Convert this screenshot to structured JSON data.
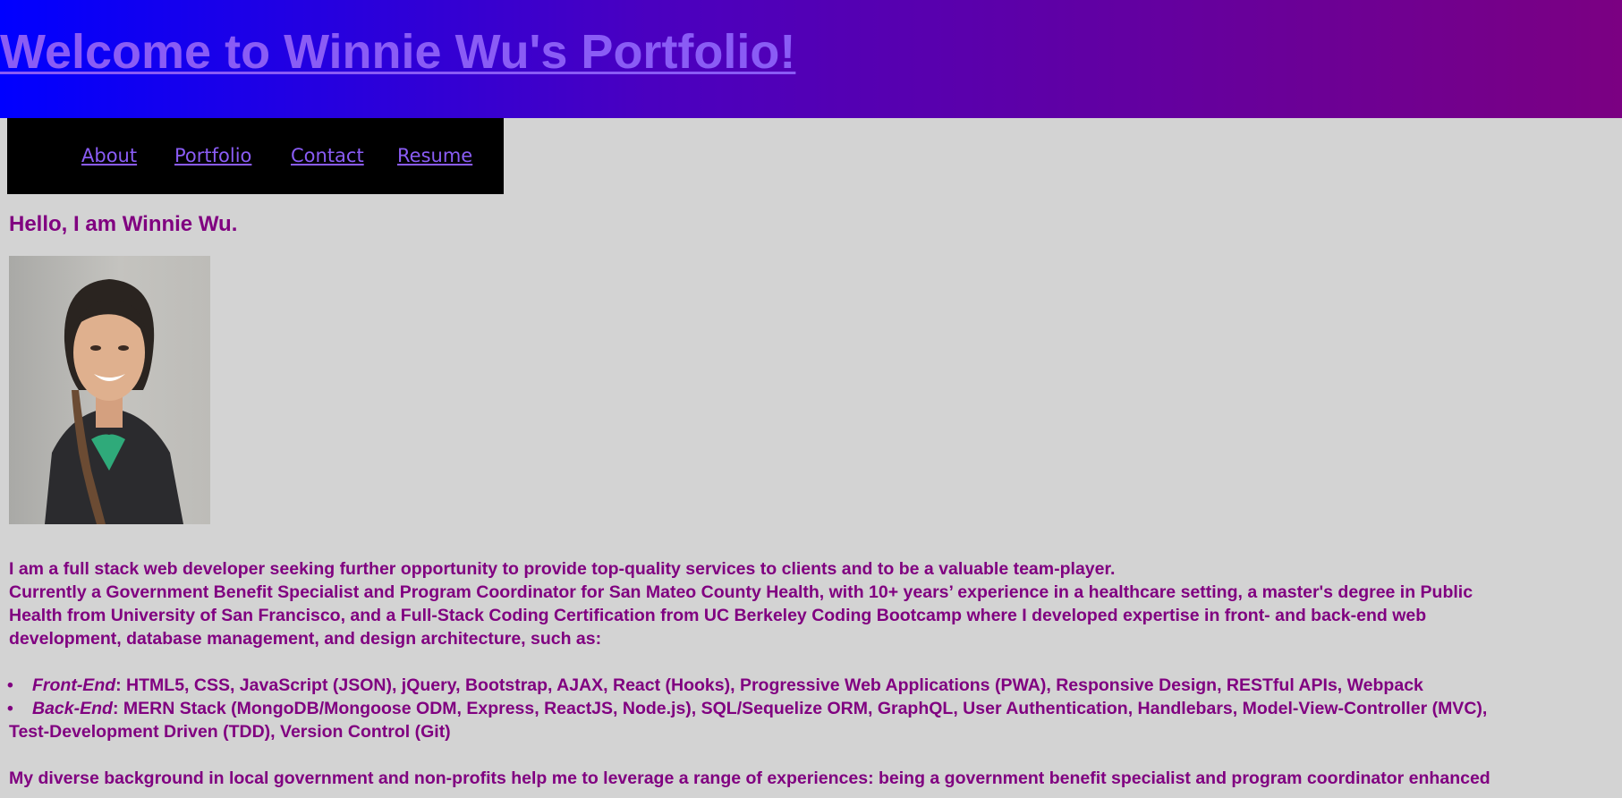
{
  "header": {
    "title": "Welcome to Winnie Wu's Portfolio!"
  },
  "nav": {
    "items": [
      {
        "label": "About"
      },
      {
        "label": "Portfolio"
      },
      {
        "label": "Contact"
      },
      {
        "label": "Resume"
      }
    ]
  },
  "about": {
    "greeting": "Hello, I am Winnie Wu.",
    "photo_icon": "profile-photo",
    "intro": "I am a full stack web developer seeking further opportunity to provide top-quality services to clients and to be a valuable team-player.",
    "background_lines": [
      "Currently a Government Benefit Specialist and Program Coordinator for San Mateo County Health, with 10+ years’ experience in a healthcare setting, a master's degree in Public",
      "Health from University of San Francisco, and a Full-Stack Coding Certification from UC Berkeley Coding Bootcamp where I developed expertise in front- and back-end web",
      "development, database management, and design architecture, such as:"
    ],
    "skills": [
      {
        "label": "Front-End",
        "lines": [
          ": HTML5, CSS, JavaScript (JSON), jQuery, Bootstrap, AJAX, React (Hooks), Progressive Web Applications (PWA), Responsive Design, RESTful APIs, Webpack"
        ]
      },
      {
        "label": "Back-End",
        "lines": [
          ": MERN Stack (MongoDB/Mongoose ODM, Express, ReactJS, Node.js), SQL/Sequelize ORM, GraphQL, User Authentication, Handlebars, Model-View-Controller (MVC),",
          "Test-Development Driven (TDD), Version Control (Git)"
        ]
      }
    ],
    "closing": "My diverse background in local government and non-profits help me to leverage a range of experiences: being a government benefit specialist and program coordinator enhanced"
  },
  "colors": {
    "background": "#d3d3d3",
    "header_start": "#0000ff",
    "header_end": "#7b0082",
    "link": "#8a5cf5",
    "text": "#800080",
    "nav_background": "#000000"
  }
}
